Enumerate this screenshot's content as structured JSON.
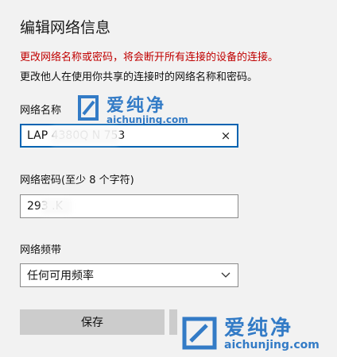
{
  "dialog": {
    "title": "编辑网络信息",
    "warning": "更改网络名称或密码，将会断开所有连接的设备的连接。",
    "info": "更改他人在使用你共享的连接时的网络名称和密码。"
  },
  "network_name": {
    "label": "网络名称",
    "value": "LAP         4380Q N 753",
    "clear_icon": "×"
  },
  "password": {
    "label": "网络密码(至少 8 个字符)",
    "value": "293      .K"
  },
  "band": {
    "label": "网络频带",
    "selected": "任何可用频率"
  },
  "buttons": {
    "save": "保存"
  },
  "watermark": {
    "name": "爱纯净",
    "url": "aichunjing.com",
    "color": "#1f6fc2"
  },
  "colors": {
    "warning": "#c00000",
    "focus_border": "#0063b1",
    "background": "#f2f2f2"
  }
}
